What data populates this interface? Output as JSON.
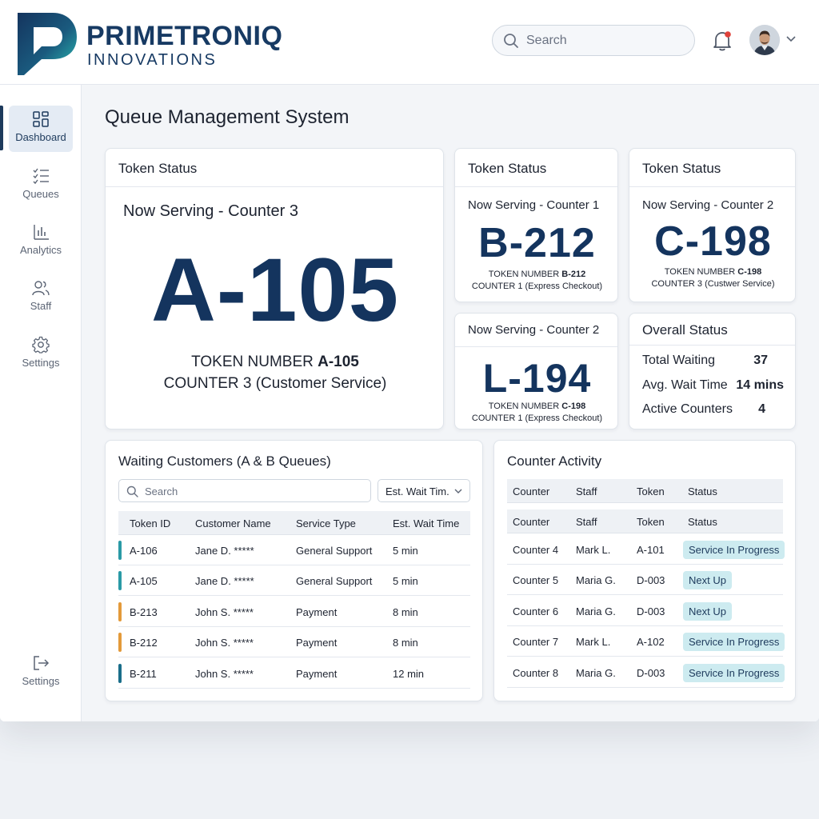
{
  "brand": {
    "name_line1": "PRIMETRONIQ",
    "name_line2": "INNOVATIONS"
  },
  "header": {
    "search_placeholder": "Search",
    "notification_dot": true
  },
  "sidebar": {
    "items": [
      {
        "label": "Dashboard",
        "icon": "grid-icon",
        "active": true
      },
      {
        "label": "Queues",
        "icon": "checklist-icon",
        "active": false
      },
      {
        "label": "Analytics",
        "icon": "bar-chart-icon",
        "active": false
      },
      {
        "label": "Staff",
        "icon": "users-icon",
        "active": false
      },
      {
        "label": "Settings",
        "icon": "gear-icon",
        "active": false
      }
    ],
    "bottom_item": {
      "label": "Settings",
      "icon": "logout-icon"
    }
  },
  "page": {
    "title": "Queue Management System"
  },
  "token_main": {
    "title": "Token Status",
    "serving": "Now Serving - Counter 3",
    "token": "A-105",
    "line1_prefix": "TOKEN NUMBER ",
    "line1_token": "A-105",
    "line2": "COUNTER 3 (Customer Service)"
  },
  "token_c1": {
    "title": "Token Status",
    "serving": "Now Serving - Counter 1",
    "token": "B-212",
    "line1_prefix": "TOKEN NUMBER ",
    "line1_token": "B-212",
    "line2": "COUNTER 1 (Express Checkout)"
  },
  "token_c2": {
    "title": "Token Status",
    "serving": "Now Serving - Counter 2",
    "token": "C-198",
    "line1_prefix": "TOKEN NUMBER ",
    "line1_token": "C-198",
    "line2": "COUNTER 3 (Custwer Service)"
  },
  "token_l": {
    "serving": "Now Serving - Counter 2",
    "token": "L-194",
    "line1_prefix": "TOKEN NUMBER ",
    "line1_token": "C-198",
    "line2": "COUNTER 1 (Express Checkout)"
  },
  "overall": {
    "title": "Overall Status",
    "rows": [
      {
        "label": "Total Waiting",
        "value": "37"
      },
      {
        "label": "Avg. Wait Time",
        "value": "14 mins"
      },
      {
        "label": "Active Counters",
        "value": "4"
      }
    ]
  },
  "waiting": {
    "title": "Waiting Customers (A & B Queues)",
    "search_placeholder": "Search",
    "filter_label": "Est. Wait Tim.",
    "columns": [
      "Token ID",
      "Customer Name",
      "Service Type",
      "Est. Wait Time"
    ],
    "rows": [
      {
        "token": "A-106",
        "name": "Jane D. *****",
        "service": "General Support",
        "wait": "5 min",
        "color": "#2a9aa6"
      },
      {
        "token": "A-105",
        "name": "Jane D. *****",
        "service": "General Support",
        "wait": "5 min",
        "color": "#2a9aa6"
      },
      {
        "token": "B-213",
        "name": "John S. *****",
        "service": "Payment",
        "wait": "8 min",
        "color": "#e39a3a"
      },
      {
        "token": "B-212",
        "name": "John S. *****",
        "service": "Payment",
        "wait": "8 min",
        "color": "#e39a3a"
      },
      {
        "token": "B-211",
        "name": "John S. *****",
        "service": "Payment",
        "wait": "12 min",
        "color": "#1a6e8a"
      }
    ]
  },
  "activity": {
    "title": "Counter Activity",
    "columns": [
      "Counter",
      "Staff",
      "Token",
      "Status"
    ],
    "rows": [
      {
        "counter": "Counter 4",
        "staff": "Mark L.",
        "token": "A-101",
        "status": "Service In Progress"
      },
      {
        "counter": "Counter 5",
        "staff": "Maria G.",
        "token": "D-003",
        "status": "Next Up"
      },
      {
        "counter": "Counter 6",
        "staff": "Maria G.",
        "token": "D-003",
        "status": "Next Up"
      },
      {
        "counter": "Counter 7",
        "staff": "Mark L.",
        "token": "A-102",
        "status": "Service In Progress"
      },
      {
        "counter": "Counter 8",
        "staff": "Maria G.",
        "token": "D-003",
        "status": "Service In Progress"
      }
    ]
  },
  "colors": {
    "brand_navy": "#14345e",
    "brand_teal": "#2bb3b1",
    "badge_bg": "#cdebf0"
  }
}
